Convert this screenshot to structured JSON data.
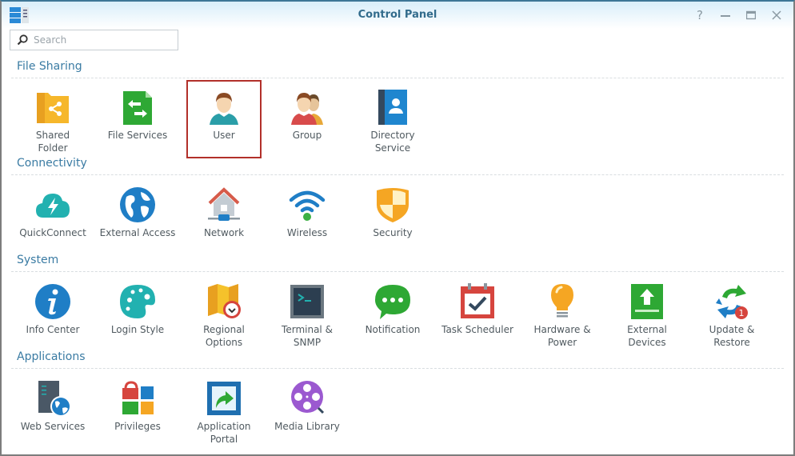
{
  "window": {
    "title": "Control Panel",
    "controls": [
      "help",
      "minimize",
      "maximize",
      "close"
    ]
  },
  "search": {
    "placeholder": "Search",
    "value": ""
  },
  "sections": [
    {
      "title": "File Sharing",
      "items": [
        {
          "label": "Shared Folder",
          "icon": "shared-folder-icon"
        },
        {
          "label": "File Services",
          "icon": "file-services-icon"
        },
        {
          "label": "User",
          "icon": "user-icon",
          "selected": true
        },
        {
          "label": "Group",
          "icon": "group-icon"
        },
        {
          "label": "Directory Service",
          "icon": "directory-service-icon"
        }
      ]
    },
    {
      "title": "Connectivity",
      "items": [
        {
          "label": "QuickConnect",
          "icon": "quickconnect-icon"
        },
        {
          "label": "External Access",
          "icon": "external-access-icon"
        },
        {
          "label": "Network",
          "icon": "network-icon"
        },
        {
          "label": "Wireless",
          "icon": "wireless-icon"
        },
        {
          "label": "Security",
          "icon": "security-icon"
        }
      ]
    },
    {
      "title": "System",
      "items": [
        {
          "label": "Info Center",
          "icon": "info-center-icon"
        },
        {
          "label": "Login Style",
          "icon": "login-style-icon"
        },
        {
          "label": "Regional Options",
          "icon": "regional-options-icon"
        },
        {
          "label": "Terminal & SNMP",
          "icon": "terminal-icon"
        },
        {
          "label": "Notification",
          "icon": "notification-icon"
        },
        {
          "label": "Task Scheduler",
          "icon": "task-scheduler-icon"
        },
        {
          "label": "Hardware & Power",
          "icon": "hardware-power-icon"
        },
        {
          "label": "External Devices",
          "icon": "external-devices-icon"
        },
        {
          "label": "Update & Restore",
          "icon": "update-restore-icon",
          "badge": "1"
        }
      ]
    },
    {
      "title": "Applications",
      "items": [
        {
          "label": "Web Services",
          "icon": "web-services-icon"
        },
        {
          "label": "Privileges",
          "icon": "privileges-icon"
        },
        {
          "label": "Application Portal",
          "icon": "application-portal-icon"
        },
        {
          "label": "Media Library",
          "icon": "media-library-icon"
        }
      ]
    }
  ],
  "labels": {
    "s0": [
      "Shared",
      "Folder"
    ],
    "s0b": "File Services",
    "s0c": "User",
    "s0d": "Group",
    "s0e": [
      "Directory",
      "Service"
    ],
    "reg": [
      "Regional",
      "Options"
    ],
    "term": [
      "Terminal &",
      "SNMP"
    ],
    "hw": [
      "Hardware &",
      "Power"
    ],
    "ext": [
      "External",
      "Devices"
    ],
    "upd": [
      "Update &",
      "Restore"
    ],
    "portal": [
      "Application",
      "Portal"
    ]
  }
}
